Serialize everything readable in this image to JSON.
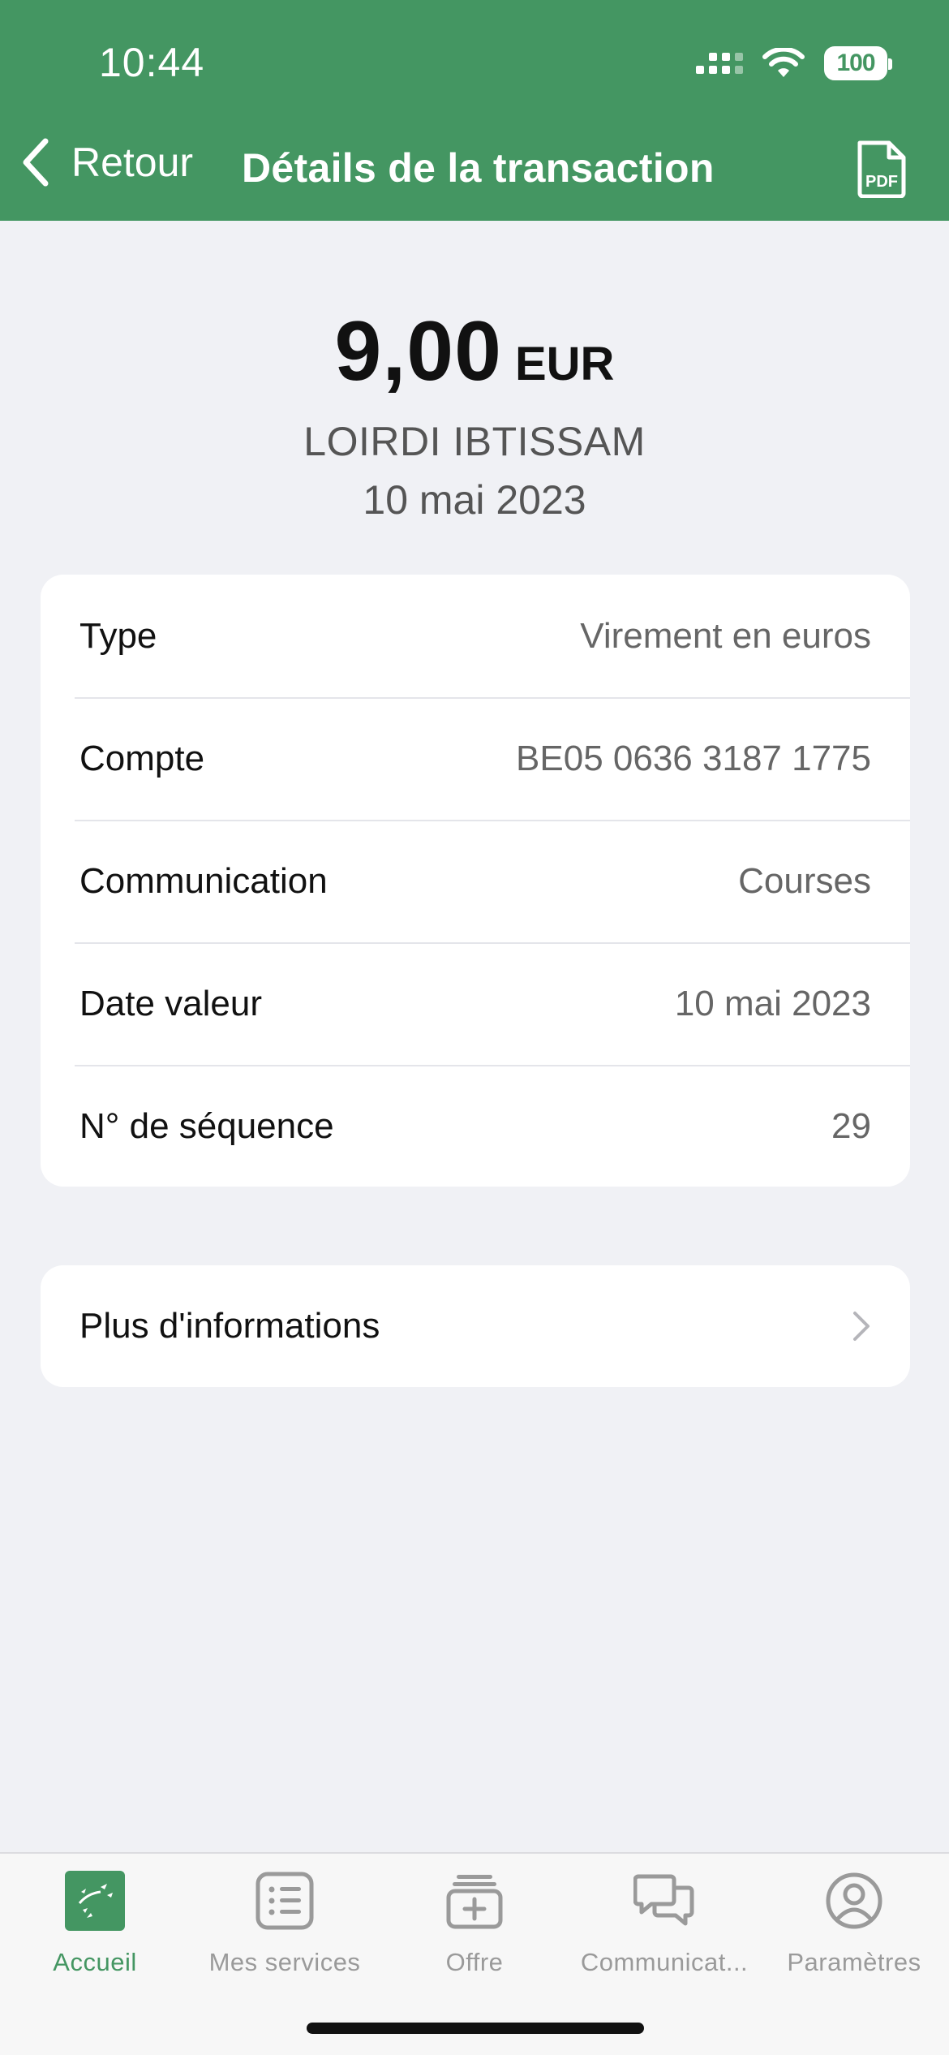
{
  "status_bar": {
    "time": "10:44",
    "battery": "100"
  },
  "nav": {
    "back_label": "Retour",
    "title": "Détails de la transaction",
    "pdf_label": "PDF"
  },
  "transaction": {
    "amount": "9,00",
    "currency": "EUR",
    "payee": "LOIRDI IBTISSAM",
    "date": "10 mai 2023"
  },
  "details": [
    {
      "label": "Type",
      "value": "Virement en euros"
    },
    {
      "label": "Compte",
      "value": "BE05 0636 3187 1775"
    },
    {
      "label": "Communication",
      "value": "Courses"
    },
    {
      "label": "Date valeur",
      "value": "10 mai 2023"
    },
    {
      "label": "N° de séquence",
      "value": "29"
    }
  ],
  "more_info": {
    "label": "Plus d'informations"
  },
  "tabbar": {
    "items": [
      {
        "label": "Accueil",
        "icon": "bnp-logo-icon",
        "active": true
      },
      {
        "label": "Mes services",
        "icon": "list-icon"
      },
      {
        "label": "Offre",
        "icon": "offer-box-icon"
      },
      {
        "label": "Communicat...",
        "icon": "chat-bubbles-icon"
      },
      {
        "label": "Paramètres",
        "icon": "user-circle-icon"
      }
    ]
  },
  "colors": {
    "brand_green": "#449662",
    "background": "#f0f1f5"
  }
}
